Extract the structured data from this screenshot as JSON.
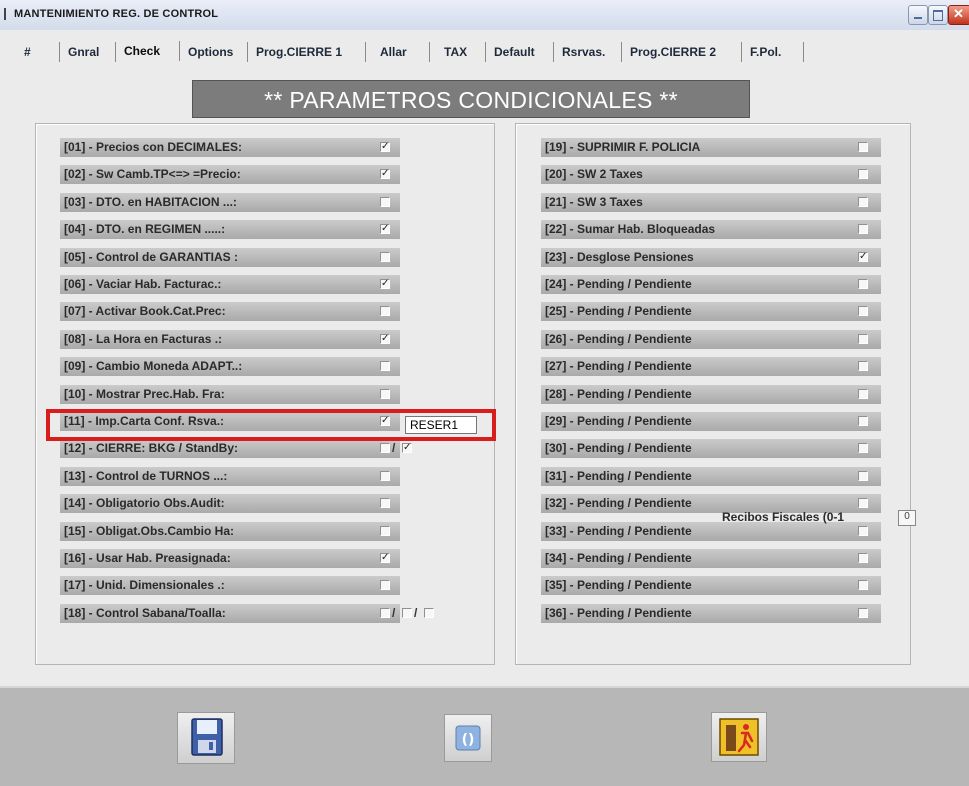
{
  "window": {
    "title": "MANTENIMIENTO REG. DE CONTROL"
  },
  "tabs": [
    {
      "label": "#"
    },
    {
      "label": "Gnral"
    },
    {
      "label": "Check",
      "active": true
    },
    {
      "label": "Options"
    },
    {
      "label": "Prog.CIERRE 1"
    },
    {
      "label": "Allar"
    },
    {
      "label": "TAX"
    },
    {
      "label": "Default"
    },
    {
      "label": "Rsrvas."
    },
    {
      "label": "Prog.CIERRE 2"
    },
    {
      "label": "F.Pol."
    }
  ],
  "header": {
    "title": "** PARAMETROS CONDICIONALES **"
  },
  "left_params": [
    {
      "label": "[01] - Precios con DECIMALES:",
      "checked": true
    },
    {
      "label": "[02] - Sw Camb.TP<=> =Precio:",
      "checked": true
    },
    {
      "label": "[03] - DTO. en HABITACION ...:",
      "checked": false
    },
    {
      "label": "[04] - DTO. en REGIMEN .....:",
      "checked": true
    },
    {
      "label": "[05] - Control de GARANTIAS :",
      "checked": false
    },
    {
      "label": "[06] - Vaciar Hab. Facturac.:",
      "checked": true
    },
    {
      "label": "[07] - Activar Book.Cat.Prec:",
      "checked": false
    },
    {
      "label": "[08] - La Hora en Facturas .:",
      "checked": true
    },
    {
      "label": "[09] - Cambio Moneda ADAPT..:",
      "checked": false
    },
    {
      "label": "[10] - Mostrar Prec.Hab. Fra:",
      "checked": false
    },
    {
      "label": "[11] - Imp.Carta Conf. Rsva.:",
      "checked": true,
      "value": "RESER1"
    },
    {
      "label": "[12] - CIERRE: BKG / StandBy:",
      "checks": [
        false,
        true
      ]
    },
    {
      "label": "[13] - Control de TURNOS ...:",
      "checked": false
    },
    {
      "label": "[14] - Obligatorio Obs.Audit:",
      "checked": false
    },
    {
      "label": "[15] - Obligat.Obs.Cambio Ha:",
      "checked": false
    },
    {
      "label": "[16] - Usar Hab. Preasignada:",
      "checked": true
    },
    {
      "label": "[17] - Unid. Dimensionales .:",
      "checked": false
    },
    {
      "label": "[18] - Control Sabana/Toalla:",
      "checks": [
        false,
        false,
        false
      ]
    }
  ],
  "right_params": [
    {
      "label": "[19] - SUPRIMIR F. POLICIA",
      "checked": false
    },
    {
      "label": "[20] - SW 2 Taxes",
      "checked": false
    },
    {
      "label": "[21] - SW 3 Taxes",
      "checked": false
    },
    {
      "label": "[22] - Sumar Hab. Bloqueadas",
      "checked": false
    },
    {
      "label": "[23] - Desglose Pensiones",
      "checked": true
    },
    {
      "label": "[24] - Pending / Pendiente",
      "checked": false
    },
    {
      "label": "[25] - Pending / Pendiente",
      "checked": false
    },
    {
      "label": "[26] - Pending / Pendiente",
      "checked": false
    },
    {
      "label": "[27] - Pending / Pendiente",
      "checked": false
    },
    {
      "label": "[28] - Pending / Pendiente",
      "checked": false
    },
    {
      "label": "[29] - Pending / Pendiente",
      "checked": false
    },
    {
      "label": "[30] - Pending / Pendiente",
      "checked": false
    },
    {
      "label": "[31] - Pending / Pendiente",
      "checked": false
    },
    {
      "label": "[32] - Pending / Pendiente",
      "checked": false
    },
    {
      "label": "[33] - Pending / Pendiente",
      "checked": false
    },
    {
      "label": "[34] - Pending / Pendiente",
      "checked": false
    },
    {
      "label": "[35] - Pending / Pendiente",
      "checked": false
    },
    {
      "label": "[36] - Pending / Pendiente",
      "checked": false
    }
  ],
  "recibos": {
    "label": "Recibos Fiscales (0-1",
    "value": "0"
  },
  "colors": {
    "highlight": "#d91c1c",
    "banner": "#7c7c7c",
    "row": "#b9b9b9"
  },
  "footer": {
    "icons": [
      "floppy-disk-icon",
      "refresh-icon",
      "exit-door-icon"
    ]
  }
}
